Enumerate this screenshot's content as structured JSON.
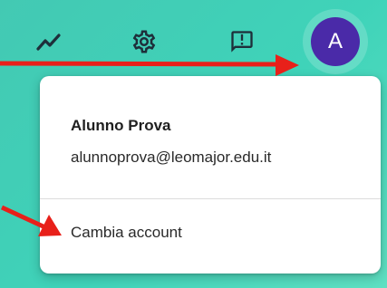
{
  "toolbar": {
    "icons": [
      "trend-icon",
      "gear-icon",
      "feedback-icon"
    ]
  },
  "account": {
    "avatar_letter": "A",
    "avatar_color": "#4a2aa8",
    "name": "Alunno Prova",
    "email": "alunnoprova@leomajor.edu.it",
    "switch_account_label": "Cambia account"
  },
  "annotations": {
    "arrow_color": "#e8201a"
  }
}
